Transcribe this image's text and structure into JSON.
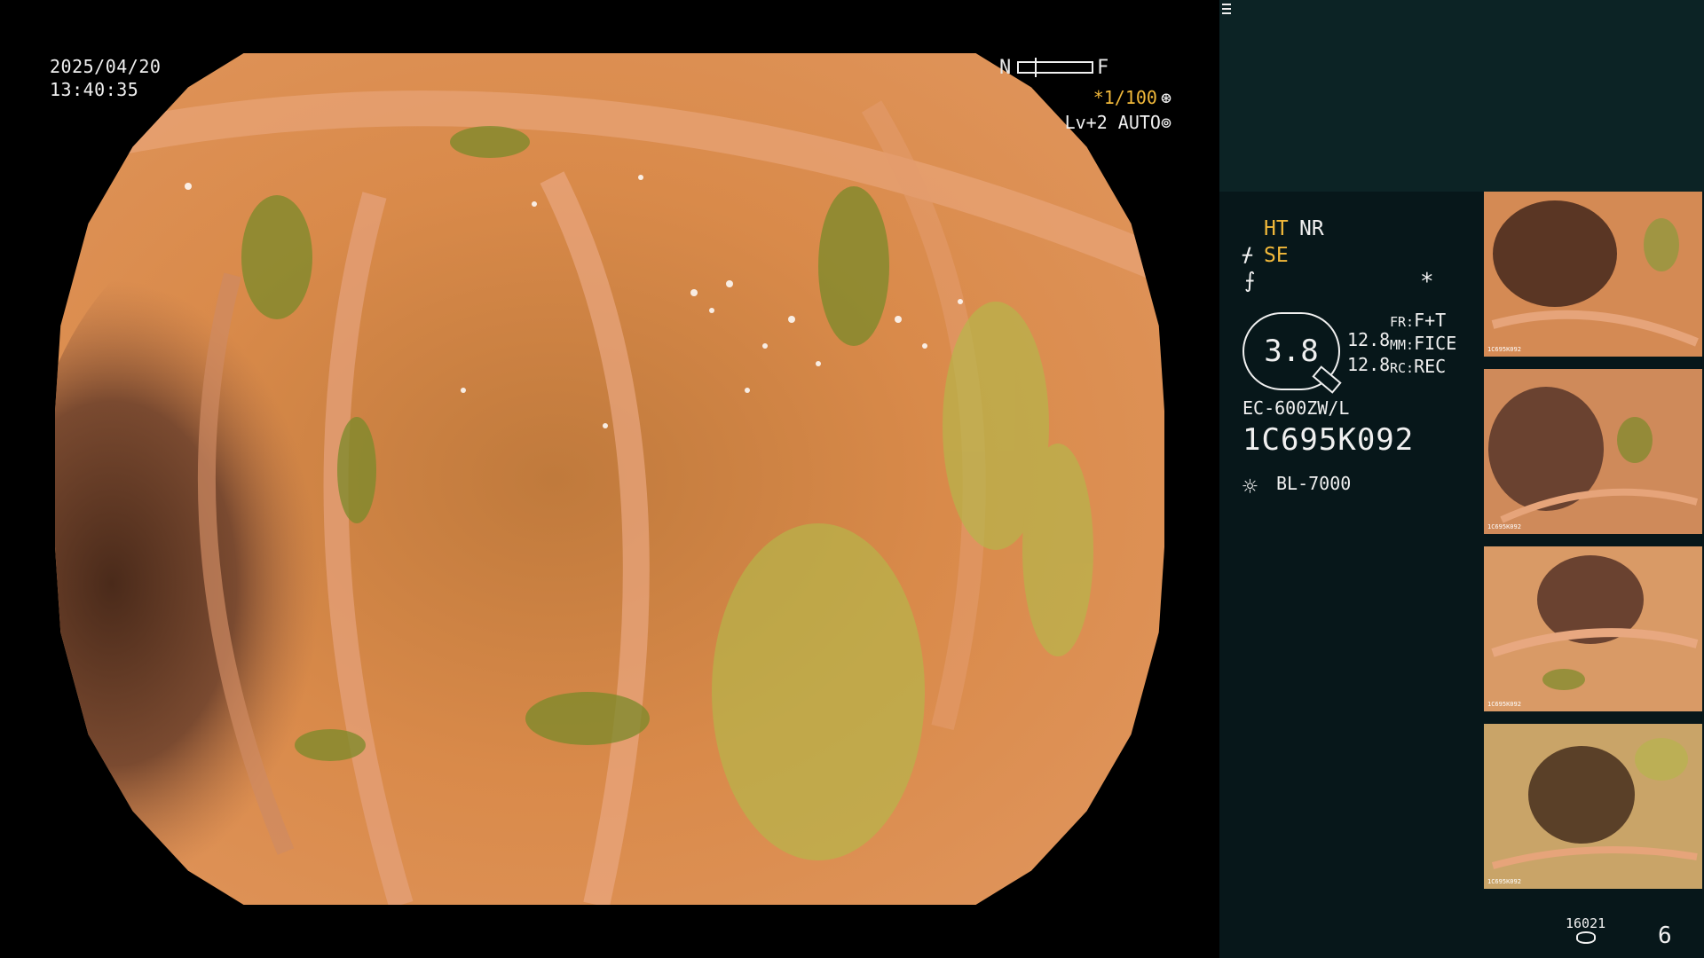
{
  "datetime": {
    "date": "2025/04/20",
    "time": "13:40:35"
  },
  "focus_gauge": {
    "near_label": "N",
    "far_label": "F"
  },
  "capture": {
    "shutter": "*1/100",
    "shutter_icon": "aperture-icon",
    "level": "Lv+2 AUTO",
    "level_icon": "iris-icon"
  },
  "panel": {
    "ht_label": "HT",
    "nr_label": "NR",
    "se_label": "SE",
    "se_icon": "structure-enhancement-icon",
    "struct_icon": "color-enhancement-icon",
    "menu_icon": "menu-list-icon",
    "asterisk": "*",
    "zoom": "3.8",
    "value_top": "12.8",
    "value_bottom": "12.8",
    "fr_key": "FR:",
    "fr_val": "F+T",
    "mm_key": "MM:",
    "mm_val": "FICE",
    "rc_key": "RC:",
    "rc_val": "REC",
    "scope_model": "EC-600ZW/L",
    "scope_serial": "1C695K092",
    "light_icon": "light-source-icon",
    "light_model": "BL-7000"
  },
  "thumbnails": [
    {
      "caption": "1C695K092"
    },
    {
      "caption": "1C695K092"
    },
    {
      "caption": "1C695K092"
    },
    {
      "caption": "1C695K092"
    }
  ],
  "footer": {
    "counter": "16021",
    "counter_icon": "storage-disk-icon",
    "image_count": "6"
  },
  "colors": {
    "accent_orange": "#f2b93a",
    "panel_bg": "#07171a",
    "panel_top_bg": "#0c2325"
  }
}
